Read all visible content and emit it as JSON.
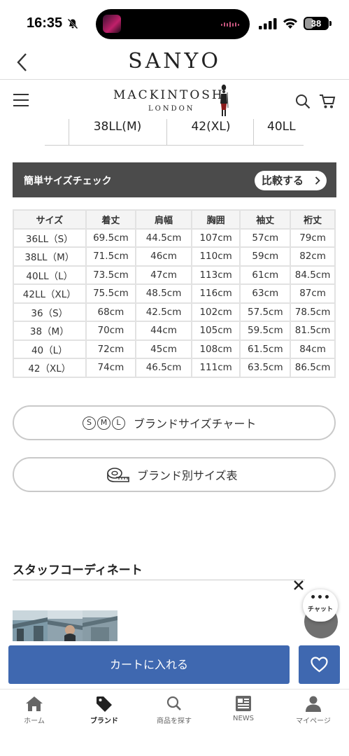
{
  "status_bar": {
    "time": "16:35",
    "battery": "38",
    "battery_level_percent": 38
  },
  "app_bar": {
    "title": "SANYO"
  },
  "brand_header": {
    "logo_main": "MACKINTOSH",
    "logo_sub": "LONDON"
  },
  "size_tabs": [
    "38LL(M)",
    "42(XL)",
    "40LL"
  ],
  "size_check": {
    "title": "簡単サイズチェック",
    "compare_label": "比較する"
  },
  "size_table": {
    "headers": [
      "サイズ",
      "着丈",
      "肩幅",
      "胸囲",
      "袖丈",
      "裄丈"
    ],
    "rows": [
      [
        "36LL（S）",
        "69.5cm",
        "44.5cm",
        "107cm",
        "57cm",
        "79cm"
      ],
      [
        "38LL（M）",
        "71.5cm",
        "46cm",
        "110cm",
        "59cm",
        "82cm"
      ],
      [
        "40LL（L）",
        "73.5cm",
        "47cm",
        "113cm",
        "61cm",
        "84.5cm"
      ],
      [
        "42LL（XL）",
        "75.5cm",
        "48.5cm",
        "116cm",
        "63cm",
        "87cm"
      ],
      [
        "36（S）",
        "68cm",
        "42.5cm",
        "102cm",
        "57.5cm",
        "78.5cm"
      ],
      [
        "38（M）",
        "70cm",
        "44cm",
        "105cm",
        "59.5cm",
        "81.5cm"
      ],
      [
        "40（L）",
        "72cm",
        "45cm",
        "108cm",
        "61.5cm",
        "84cm"
      ],
      [
        "42（XL）",
        "74cm",
        "46.5cm",
        "111cm",
        "63.5cm",
        "86.5cm"
      ]
    ]
  },
  "brand_size_chart": {
    "label": "ブランドサイズチャート",
    "icon_letters": [
      "S",
      "M",
      "L"
    ]
  },
  "brand_size_table": {
    "label": "ブランド別サイズ表"
  },
  "staff": {
    "title": "スタッフコーディネート"
  },
  "chat": {
    "dots": "•••",
    "label": "チャット"
  },
  "cart": {
    "add_label": "カートに入れる"
  },
  "tab_bar": {
    "items": [
      {
        "label": "ホーム",
        "icon": "home-icon"
      },
      {
        "label": "ブランド",
        "icon": "tag-icon"
      },
      {
        "label": "商品を探す",
        "icon": "search-icon"
      },
      {
        "label": "NEWS",
        "icon": "news-icon"
      },
      {
        "label": "マイページ",
        "icon": "person-icon"
      }
    ],
    "active": "ブランド"
  },
  "colors": {
    "primary": "#3f68b0",
    "banner": "#4b4b4b",
    "table_header": "#f4f4f4",
    "border": "#e2e2e2"
  }
}
